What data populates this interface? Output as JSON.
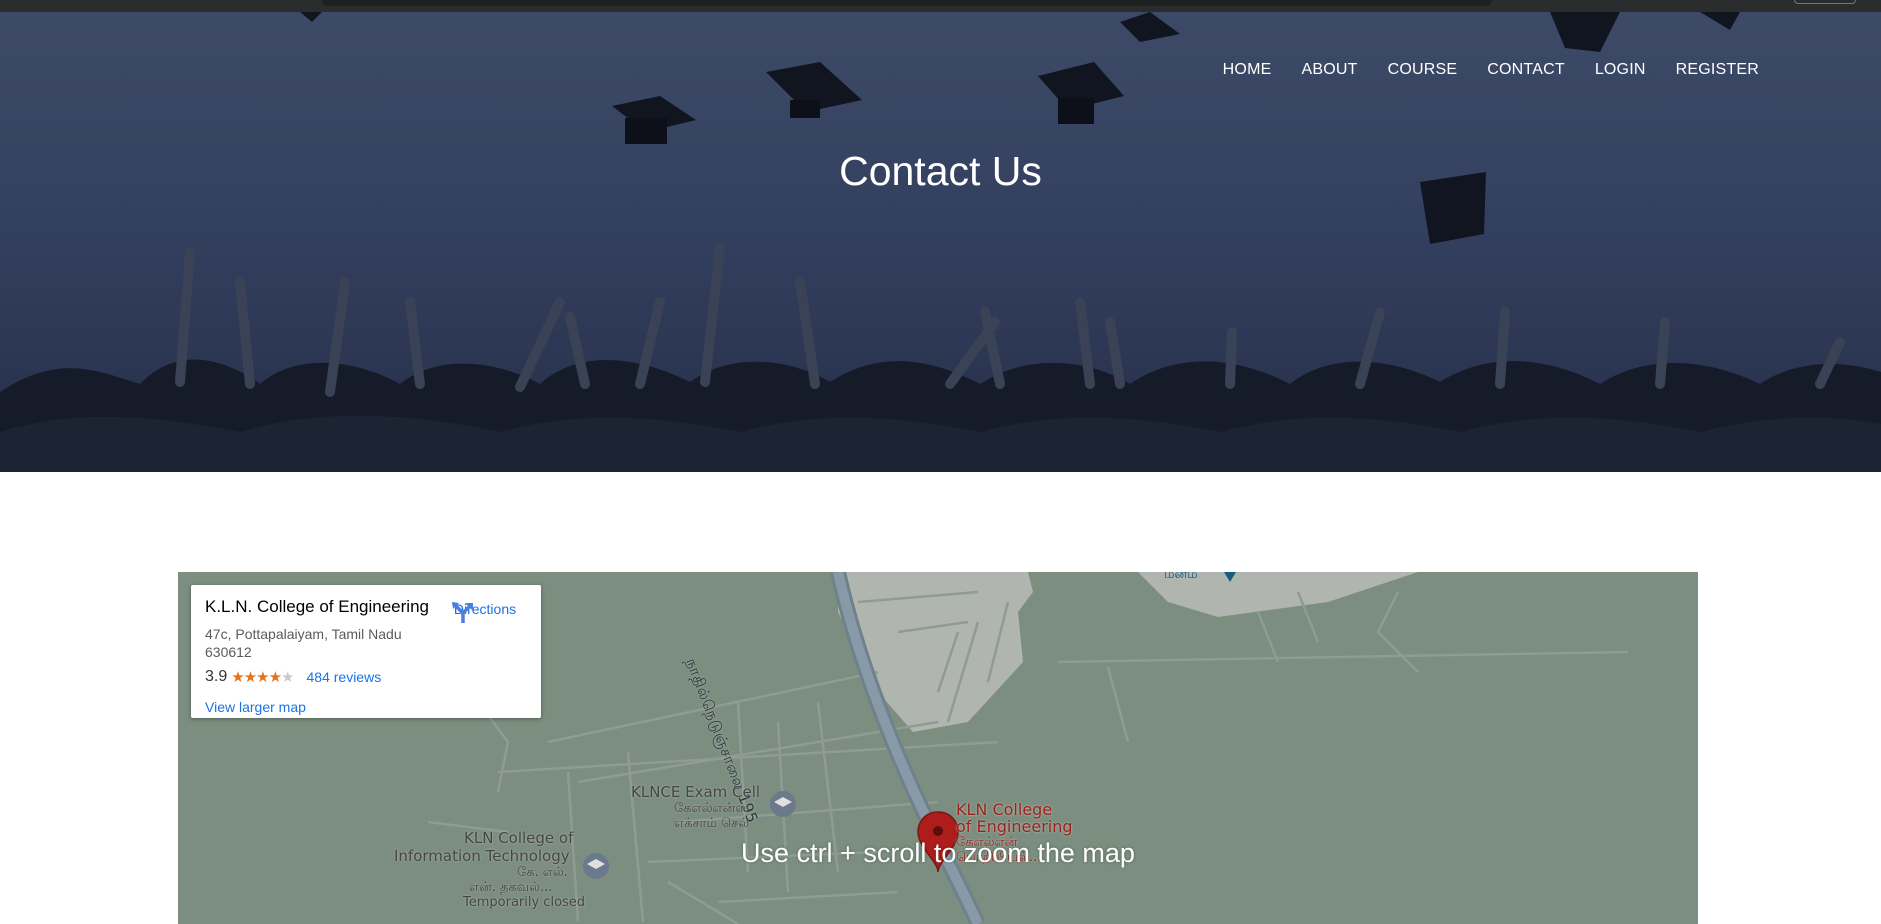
{
  "nav": {
    "items": [
      "HOME",
      "ABOUT",
      "COURSE",
      "CONTACT",
      "LOGIN",
      "REGISTER"
    ]
  },
  "hero": {
    "title": "Contact Us"
  },
  "map": {
    "zoom_hint": "Use ctrl + scroll to zoom the map",
    "place": {
      "name": "K.L.N. College of Engineering",
      "address_line1": "47c, Pottapalaiyam, Tamil Nadu",
      "address_line2": "630612",
      "rating": "3.9",
      "reviews": "484 reviews",
      "larger_map": "View larger map",
      "directions": "Directions",
      "stars_filled": 4,
      "stars_total": 5
    },
    "labels": {
      "road": "நாதில்நெடுஞ்சாலை 195",
      "top_right": "மீனம்",
      "exam_cell_en": "KLNCE Exam Cell",
      "exam_cell_ta1": "கேஎல்என்ஸ்",
      "exam_cell_ta2": "எக்சாம் செல்",
      "it_en1": "KLN College of",
      "it_en2": "Information Technology",
      "it_ta1": "கே. எல்.",
      "it_ta2": "என். தகவல்...",
      "it_status": "Temporarily closed",
      "kln_en1": "KLN College",
      "kln_en2": "of Engineering",
      "kln_ta1": "கேஎல்என்",
      "kln_ta2": "பொறியியல்..."
    },
    "colors": {
      "link": "#1a73e8",
      "star": "#e7711b",
      "pin": "#c5221f",
      "map_bg": "#8da291"
    }
  }
}
